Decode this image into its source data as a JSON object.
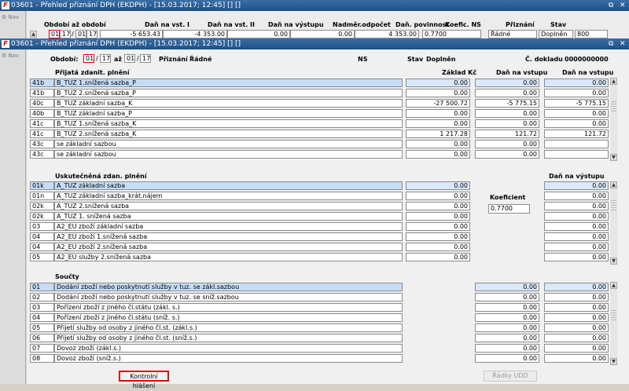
{
  "window1": {
    "title": "03601 - Přehled přiznání DPH (EKDPH) - [15.03.2017; 12:45] [] []",
    "nav_label": "Nav",
    "headers": [
      "Období až období",
      "Daň na vst. I",
      "Daň na vst. II",
      "Daň na výstupu",
      "Nadměr.odpočet",
      "Daň. povinnost",
      "Koefic. NS",
      "Přiznání",
      "Stav"
    ],
    "row": {
      "m1": "01",
      "y1": "17",
      "m2": "01",
      "y2": "17",
      "dan_vst_1": "-5 653.43",
      "dan_vst_2": "-4 353.00",
      "dan_vystup": "0.00",
      "nadmer": "0.00",
      "povinnost": "4 353.00",
      "koef": "0.7700",
      "priznani": "Řádné",
      "stav": "Doplněn",
      "extra": "800"
    }
  },
  "window2": {
    "title": "03601 - Přehled přiznání DPH (EKDPH) - [15.03.2017; 12:45] [] []",
    "nav_label": "Nav",
    "top": {
      "obdobi_label": "Období:",
      "m1": "01",
      "y1": "17",
      "az": "až",
      "m2": "01",
      "y2": "17",
      "priznani_label": "Přiznání",
      "priznani": "Řádné",
      "ns_label": "NS",
      "stav_label": "Stav",
      "stav": "Doplněn",
      "cdokladu_label": "Č. dokladu",
      "cdokladu": "0000000000"
    },
    "s1": {
      "title": "Přijatá zdanit. plnění",
      "cols": [
        "Základ Kč",
        "Daň na vstupu",
        "Daň na vstupu"
      ],
      "rows": [
        {
          "code": "41b",
          "name": "B_TUZ 1.snížená sazba_P",
          "c1": "0.00",
          "c2": "0.00",
          "c3": "0.00"
        },
        {
          "code": "41b",
          "name": "B_TUZ 2.snížená sazba_P",
          "c1": "0.00",
          "c2": "0.00",
          "c3": "0.00"
        },
        {
          "code": "40c",
          "name": "B_TUZ základní sazba_K",
          "c1": "-27 500.72",
          "c2": "-5 775.15",
          "c3": "-5 775.15"
        },
        {
          "code": "40b",
          "name": "B_TUZ základní sazba_P",
          "c1": "0.00",
          "c2": "0.00",
          "c3": "0.00"
        },
        {
          "code": "41c",
          "name": "B_TUZ 1.snížená sazba_K",
          "c1": "0.00",
          "c2": "0.00",
          "c3": "0.00"
        },
        {
          "code": "41c",
          "name": "B_TUZ 2.snížená sazba_K",
          "c1": "1 217.28",
          "c2": "121.72",
          "c3": "121.72"
        },
        {
          "code": "43c",
          "name": "se základní sazbou",
          "c1": "0.00",
          "c2": "0.00",
          "c3": ""
        },
        {
          "code": "43c",
          "name": "se základní sazbou",
          "c1": "0.00",
          "c2": "0.00",
          "c3": ""
        }
      ]
    },
    "s2": {
      "title": "Uskutečněná zdan. plnění",
      "col": "Daň na výstupu",
      "koef_label": "Koeficient",
      "koef": "0.7700",
      "rows": [
        {
          "code": "01k",
          "name": "A_TUZ základní sazba",
          "c1": "0.00",
          "c3": "0.00"
        },
        {
          "code": "01n",
          "name": "A_TUZ základní sazba_krát.nájem",
          "c1": "0.00",
          "c3": "0.00"
        },
        {
          "code": "02k",
          "name": "A_TUZ 2.snížená sazba",
          "c1": "0.00",
          "c3": "0.00"
        },
        {
          "code": "02k",
          "name": "A_TUZ 1. snížená sazba",
          "c1": "0.00",
          "c3": "0.00"
        },
        {
          "code": "03",
          "name": "A2_EU zboží základní sazba",
          "c1": "0.00",
          "c3": "0.00"
        },
        {
          "code": "04",
          "name": "A2_EU zboží 1.snížená sazba",
          "c1": "0.00",
          "c3": "0.00"
        },
        {
          "code": "04",
          "name": "A2_EU zboží 2.snížená sazba",
          "c1": "0.00",
          "c3": "0.00"
        },
        {
          "code": "05",
          "name": "A2_EU služby 2.snížená sazba",
          "c1": "0.00",
          "c3": "0.00"
        }
      ]
    },
    "s3": {
      "title": "Součty",
      "rows": [
        {
          "code": "01",
          "name": "Dodání zboží nebo poskytnutí služby v tuz. se zákl.sazbou",
          "c2": "0.00",
          "c3": "0.00"
        },
        {
          "code": "02",
          "name": "Dodání zboží nebo poskytnutí služby v tuz. se sníž.sazbou",
          "c2": "0.00",
          "c3": "0.00"
        },
        {
          "code": "03",
          "name": "Pořízení zboží z jiného čl.státu (zákl. s.)",
          "c2": "0.00",
          "c3": "0.00"
        },
        {
          "code": "04",
          "name": "Pořízení zboží z jiného čl.státu (sníž. s.)",
          "c2": "0.00",
          "c3": "0.00"
        },
        {
          "code": "05",
          "name": "Přijetí služby od osoby z jiného čl.st. (zákl.s.)",
          "c2": "0.00",
          "c3": "0.00"
        },
        {
          "code": "06",
          "name": "Přijetí služby od osoby z jiného čl.st. (sníž.s.)",
          "c2": "0.00",
          "c3": "0.00"
        },
        {
          "code": "07",
          "name": "Dovoz zboží (zákl.s.)",
          "c2": "0.00",
          "c3": "0.00"
        },
        {
          "code": "08",
          "name": "Dovoz zboží (sníž.s.)",
          "c2": "0.00",
          "c3": "0.00"
        }
      ]
    },
    "buttons": {
      "kontrolni": "Kontrolní hlášení",
      "radky": "Řádky UDD"
    }
  },
  "colors": {
    "title_bg": "#1f4f85",
    "highlight": "#c5ddf7",
    "button_outline": "#e00000"
  }
}
